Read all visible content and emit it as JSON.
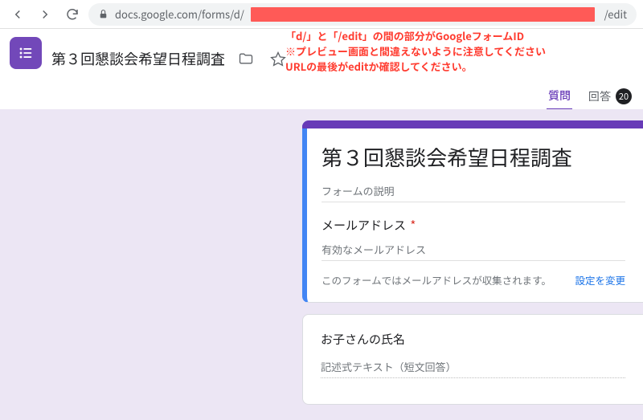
{
  "browser": {
    "url_prefix": "docs.google.com/forms/d/",
    "url_suffix": "/edit"
  },
  "header": {
    "title": "第３回懇談会希望日程調査"
  },
  "annotation": {
    "line1": "「d/」と「/edit」の間の部分がGoogleフォームID",
    "line2": "※プレビュー画面と間違えないように注意してください",
    "line3": "URLの最後がeditか確認してください。"
  },
  "tabs": {
    "questions": "質問",
    "responses": "回答",
    "responses_count": "20"
  },
  "form": {
    "title": "第３回懇談会希望日程調査",
    "description_placeholder": "フォームの説明",
    "email_label": "メールアドレス",
    "email_placeholder": "有効なメールアドレス",
    "email_note": "このフォームではメールアドレスが収集されます。",
    "email_settings": "設定を変更",
    "q2_label": "お子さんの氏名",
    "q2_placeholder": "記述式テキスト（短文回答）"
  }
}
